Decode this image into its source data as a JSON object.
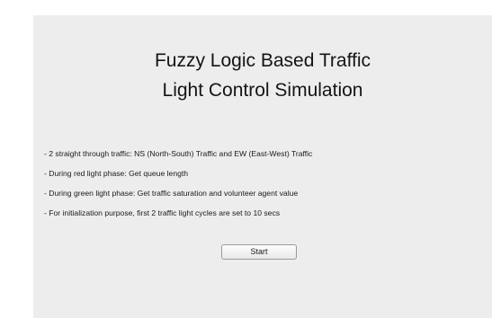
{
  "title": {
    "line1": "Fuzzy Logic Based Traffic",
    "line2": "Light Control Simulation"
  },
  "bullets": [
    "- 2 straight through traffic: NS (North-South) Traffic and EW (East-West) Traffic",
    "- During red light phase: Get queue length",
    "- During green light phase: Get traffic saturation and volunteer agent value",
    "- For initialization purpose, first 2 traffic light cycles are set to 10 secs"
  ],
  "start_button": {
    "label": "Start"
  },
  "colors": {
    "panel_background": "#ededed",
    "window_background": "#ffffff"
  }
}
